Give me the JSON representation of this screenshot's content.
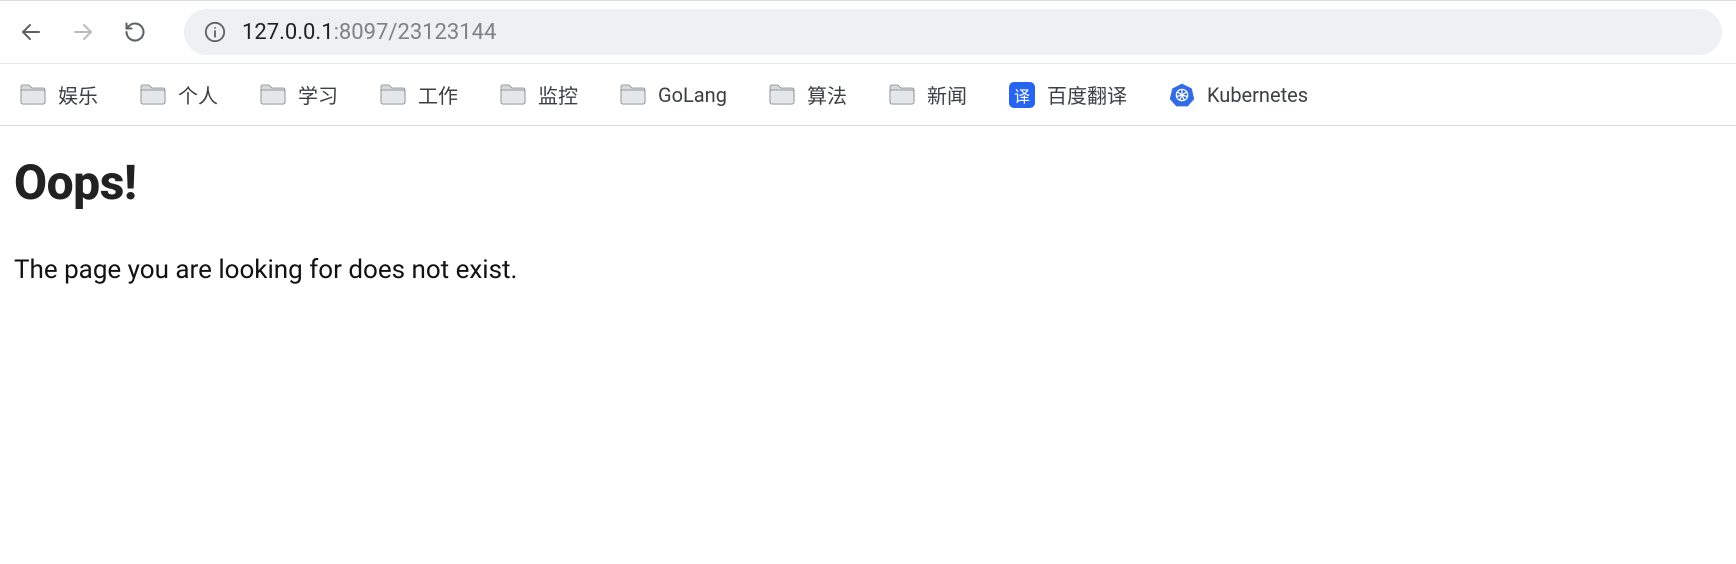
{
  "toolbar": {
    "url_host": "127.0.0.1",
    "url_path": ":8097/23123144"
  },
  "bookmarks": [
    {
      "type": "folder",
      "label": "娱乐"
    },
    {
      "type": "folder",
      "label": "个人"
    },
    {
      "type": "folder",
      "label": "学习"
    },
    {
      "type": "folder",
      "label": "工作"
    },
    {
      "type": "folder",
      "label": "监控"
    },
    {
      "type": "folder",
      "label": "GoLang"
    },
    {
      "type": "folder",
      "label": "算法"
    },
    {
      "type": "folder",
      "label": "新闻"
    },
    {
      "type": "link",
      "icon": "translate",
      "icon_char": "译",
      "label": "百度翻译"
    },
    {
      "type": "link",
      "icon": "k8s",
      "label": "Kubernetes"
    }
  ],
  "content": {
    "heading": "Oops!",
    "message": "The page you are looking for does not exist."
  }
}
